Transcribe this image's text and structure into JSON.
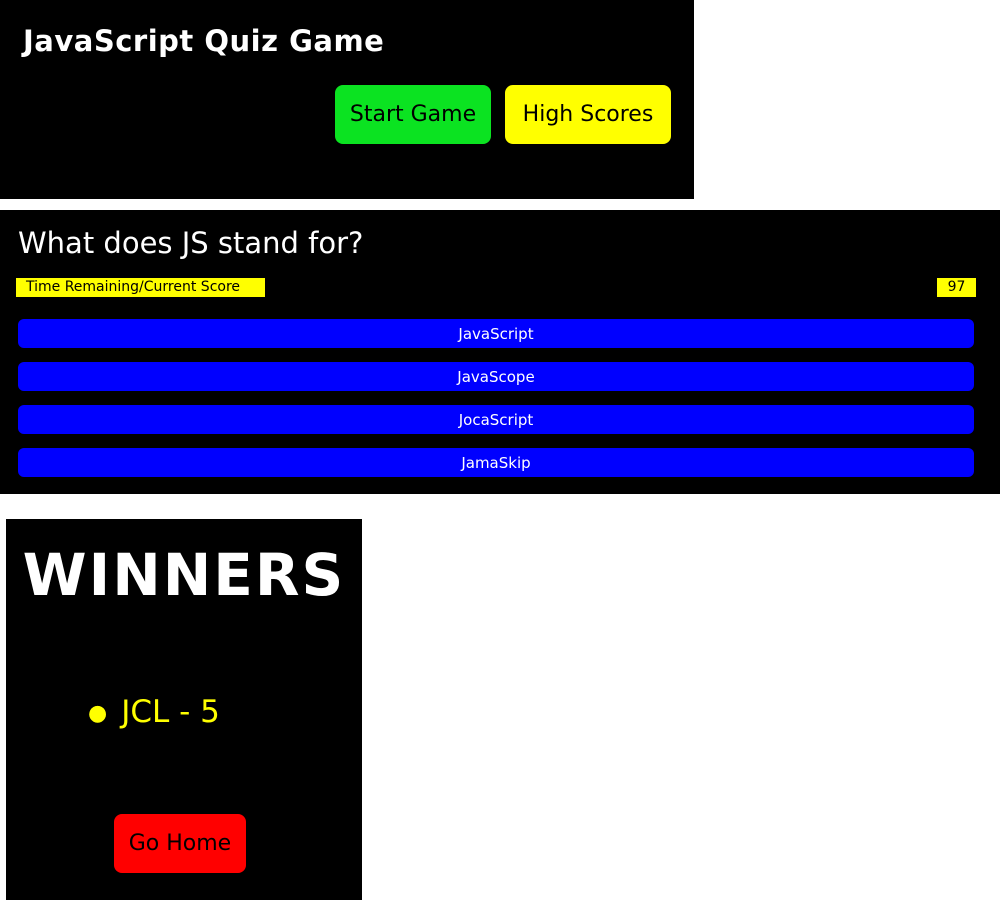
{
  "colors": {
    "panel_bg": "#000000",
    "start_button": "#0be321",
    "high_scores_button": "#ffff00",
    "answer_button": "#0000ff",
    "timer_bg": "#ffff00",
    "winner_text": "#ffff00",
    "go_home_button": "#ff0000"
  },
  "home": {
    "title": "JavaScript Quiz Game",
    "start_label": "Start Game",
    "high_scores_label": "High Scores"
  },
  "quiz": {
    "question": "What does JS stand for?",
    "timer_label": "Time Remaining/Current Score",
    "timer_value": "97",
    "answers": [
      "JavaScript",
      "JavaScope",
      "JocaScript",
      "JamaSkip"
    ]
  },
  "winners": {
    "heading": "WINNERS",
    "entries": [
      "JCL - 5"
    ],
    "bullet_icon": "bullet-icon",
    "go_home_label": "Go Home"
  }
}
